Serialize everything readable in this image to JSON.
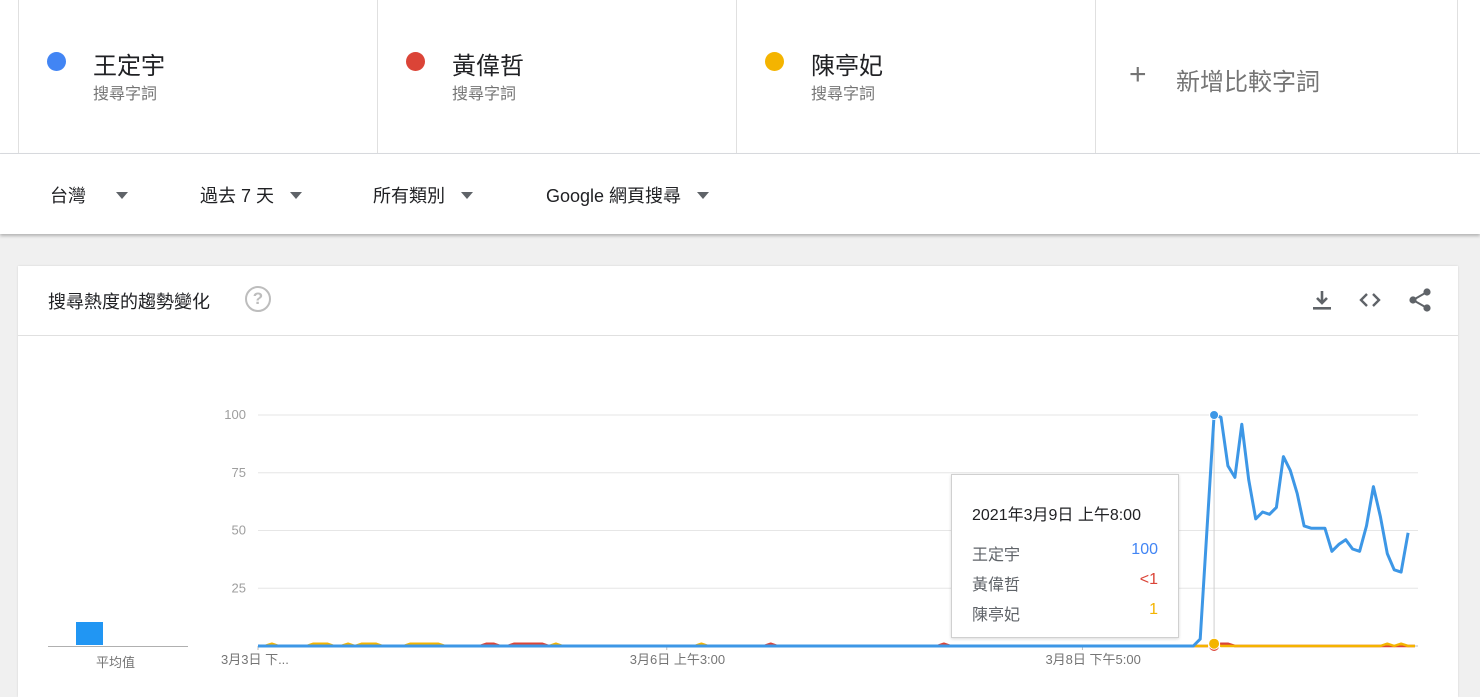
{
  "terms": [
    {
      "name": "王定宇",
      "sub": "搜尋字詞",
      "color": "#4285f4"
    },
    {
      "name": "黃偉哲",
      "sub": "搜尋字詞",
      "color": "#db4437"
    },
    {
      "name": "陳亭妃",
      "sub": "搜尋字詞",
      "color": "#f4b400"
    }
  ],
  "add_term": {
    "label": "新增比較字詞"
  },
  "filters": {
    "region": "台灣",
    "time": "過去 7 天",
    "category": "所有類別",
    "search_type": "Google 網頁搜尋"
  },
  "card": {
    "title": "搜尋熱度的趨勢變化"
  },
  "average": {
    "label": "平均值",
    "value_fraction": 0.2
  },
  "tooltip": {
    "date": "2021年3月9日 上午8:00",
    "rows": [
      {
        "name": "王定宇",
        "value": "100",
        "color": "#4285f4"
      },
      {
        "name": "黃偉哲",
        "value": "<1",
        "color": "#db4437"
      },
      {
        "name": "陳亭妃",
        "value": "1",
        "color": "#f4b400"
      }
    ]
  },
  "chart_data": {
    "type": "line",
    "x_tick_labels": [
      "3月3日 下...",
      "3月6日 上午3:00",
      "3月8日 下午5:00"
    ],
    "y_ticks": [
      25,
      50,
      75,
      100
    ],
    "ylim": [
      0,
      100
    ],
    "grid": true,
    "x_count": 168,
    "series": [
      {
        "name": "王定宇",
        "color": "#3d97e6",
        "values": [
          0,
          0,
          0,
          0,
          0,
          0,
          0,
          0,
          0,
          0,
          0,
          0,
          0,
          0,
          0,
          0,
          0,
          0,
          0,
          0,
          0,
          0,
          0,
          0,
          0,
          0,
          0,
          0,
          0,
          0,
          0,
          0,
          0,
          0,
          0,
          0,
          0,
          0,
          0,
          0,
          0,
          0,
          0,
          0,
          0,
          0,
          0,
          0,
          0,
          0,
          0,
          0,
          0,
          0,
          0,
          0,
          0,
          0,
          0,
          0,
          0,
          0,
          0,
          0,
          0,
          0,
          0,
          0,
          0,
          0,
          0,
          0,
          0,
          0,
          0,
          0,
          0,
          0,
          0,
          0,
          0,
          0,
          0,
          0,
          0,
          0,
          0,
          0,
          0,
          0,
          0,
          0,
          0,
          0,
          0,
          0,
          0,
          0,
          0,
          0,
          0,
          0,
          0,
          0,
          0,
          0,
          0,
          0,
          0,
          0,
          0,
          0,
          0,
          0,
          0,
          0,
          0,
          0,
          0,
          0,
          0,
          0,
          0,
          0,
          0,
          0,
          0,
          0,
          0,
          0,
          0,
          0,
          0,
          0,
          0,
          0,
          3,
          52,
          100,
          99,
          78,
          73,
          96,
          72,
          55,
          58,
          57,
          60,
          82,
          76,
          66,
          52,
          51,
          51,
          51,
          41,
          44,
          46,
          42,
          41,
          52,
          69,
          56,
          40,
          33,
          32,
          49
        ]
      },
      {
        "name": "黃偉哲",
        "color": "#db4437",
        "values": [
          0,
          0,
          0,
          0,
          0,
          0,
          0,
          0,
          0,
          0,
          0,
          0,
          0,
          0,
          0,
          0,
          0,
          0,
          0,
          0,
          0,
          0,
          0,
          0,
          0,
          0,
          0,
          0,
          0,
          0,
          0,
          0,
          0,
          1,
          1,
          0,
          0,
          1,
          1,
          1,
          1,
          1,
          0,
          0,
          0,
          0,
          0,
          0,
          0,
          0,
          0,
          0,
          0,
          0,
          0,
          0,
          0,
          0,
          0,
          0,
          0,
          0,
          0,
          0,
          0,
          0,
          0,
          0,
          0,
          0,
          0,
          0,
          0,
          0,
          1,
          0,
          0,
          0,
          0,
          0,
          0,
          0,
          0,
          0,
          0,
          0,
          0,
          0,
          0,
          0,
          0,
          0,
          0,
          0,
          0,
          0,
          0,
          0,
          0,
          1,
          0,
          0,
          0,
          0,
          0,
          0,
          0,
          0,
          0,
          0,
          0,
          0,
          0,
          0,
          0,
          0,
          0,
          0,
          0,
          0,
          0,
          0,
          0,
          0,
          0,
          0,
          0,
          0,
          0,
          0,
          0,
          0,
          0,
          0,
          0,
          0,
          0,
          0,
          0,
          1,
          1,
          0,
          0,
          0,
          0,
          0,
          0,
          0,
          0,
          0,
          0,
          0,
          0,
          0,
          0,
          0,
          0,
          0,
          0,
          0,
          0,
          0,
          0,
          0,
          0,
          0,
          0,
          0
        ]
      },
      {
        "name": "陳亭妃",
        "color": "#f4b400",
        "values": [
          0,
          0,
          1,
          0,
          0,
          0,
          0,
          0,
          1,
          1,
          1,
          0,
          0,
          1,
          0,
          1,
          1,
          1,
          0,
          0,
          0,
          0,
          1,
          1,
          1,
          1,
          1,
          0,
          0,
          0,
          0,
          0,
          0,
          0,
          0,
          0,
          0,
          0,
          0,
          0,
          0,
          0,
          0,
          1,
          0,
          0,
          0,
          0,
          0,
          0,
          0,
          0,
          0,
          0,
          0,
          0,
          0,
          0,
          0,
          0,
          0,
          0,
          0,
          0,
          1,
          0,
          0,
          0,
          0,
          0,
          0,
          0,
          0,
          0,
          0,
          0,
          0,
          0,
          0,
          0,
          0,
          0,
          0,
          0,
          0,
          0,
          0,
          0,
          0,
          0,
          0,
          0,
          0,
          0,
          0,
          0,
          0,
          0,
          0,
          0,
          0,
          0,
          0,
          0,
          0,
          0,
          0,
          0,
          0,
          0,
          0,
          0,
          0,
          0,
          0,
          0,
          0,
          0,
          0,
          0,
          0,
          0,
          0,
          0,
          0,
          0,
          0,
          0,
          0,
          0,
          0,
          0,
          0,
          0,
          0,
          0,
          0,
          0,
          1,
          0,
          0,
          0,
          0,
          0,
          0,
          0,
          0,
          0,
          0,
          0,
          0,
          0,
          0,
          0,
          0,
          0,
          0,
          0,
          0,
          0,
          0,
          0,
          0,
          1,
          0,
          1,
          0,
          0
        ]
      }
    ],
    "hover_index": 138
  }
}
